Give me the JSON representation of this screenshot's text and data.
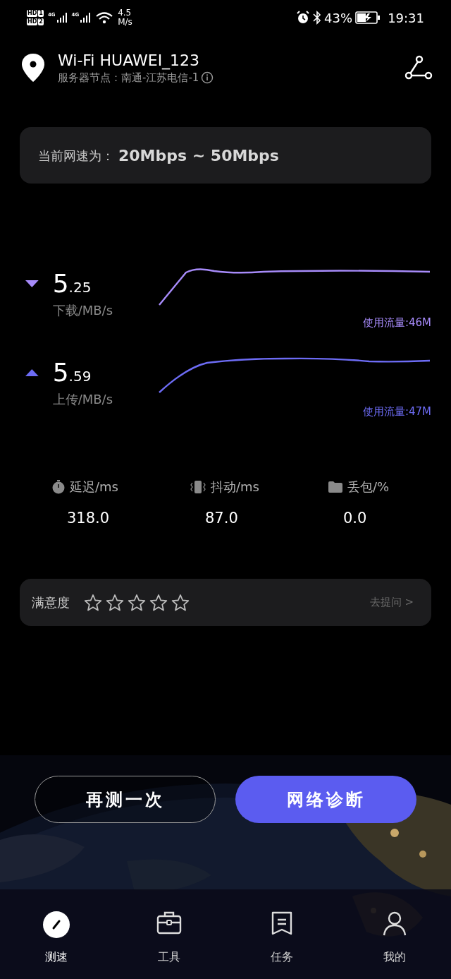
{
  "status_bar": {
    "sims": [
      {
        "hd": "HD",
        "slot": "1",
        "network": "4G"
      },
      {
        "hd": "HD",
        "slot": "2",
        "network": "4G"
      }
    ],
    "net_speed": [
      "4.5",
      "M/s"
    ],
    "battery": "43%",
    "time": "19:31"
  },
  "header": {
    "title": "Wi-Fi HUAWEI_123",
    "server": "服务器节点：南通-江苏电信-1"
  },
  "speed_card": {
    "label": "当前网速为：",
    "value": "20Mbps ~ 50Mbps"
  },
  "results": [
    {
      "kind": "download",
      "integer": "5",
      "decimal": ".25",
      "unit": "下载/MB/s",
      "usage": "使用流量:46M",
      "color": "#a78bfa"
    },
    {
      "kind": "upload",
      "integer": "5",
      "decimal": ".59",
      "unit": "上传/MB/s",
      "usage": "使用流量:47M",
      "color": "#6d6cf5"
    }
  ],
  "metrics": [
    {
      "kind": "latency",
      "label": "延迟/ms",
      "value": "318.0"
    },
    {
      "kind": "jitter",
      "label": "抖动/ms",
      "value": "87.0"
    },
    {
      "kind": "loss",
      "label": "丢包/%",
      "value": "0.0"
    }
  ],
  "satisfaction": {
    "label": "满意度",
    "stars": 0,
    "link": "去提问 >"
  },
  "buttons": [
    {
      "label": "再测一次",
      "kind": "outline"
    },
    {
      "label": "网络诊断",
      "kind": "primary"
    }
  ],
  "nav": [
    {
      "label": "测速",
      "kind": "speed",
      "selected": true
    },
    {
      "label": "工具",
      "kind": "tools",
      "selected": false
    },
    {
      "label": "任务",
      "kind": "tasks",
      "selected": false
    },
    {
      "label": "我的",
      "kind": "me",
      "selected": false
    }
  ]
}
